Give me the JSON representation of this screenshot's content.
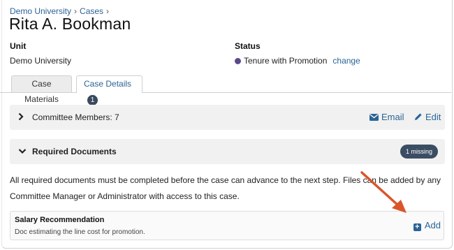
{
  "breadcrumb": {
    "items": [
      "Demo University",
      "Cases"
    ],
    "separator": "›"
  },
  "page": {
    "title": "Rita A. Bookman"
  },
  "fields": {
    "unit_label": "Unit",
    "unit_value": "Demo University",
    "status_label": "Status",
    "status_value": "Tenure with Promotion",
    "status_color": "#5a4a8a",
    "change_label": "change"
  },
  "tabs": [
    {
      "label": "Case Materials",
      "active": false
    },
    {
      "label": "Case Details",
      "active": true,
      "badge": "1"
    }
  ],
  "committee": {
    "title": "Committee Members: 7",
    "email_label": "Email",
    "edit_label": "Edit",
    "email_icon": "envelope-icon",
    "edit_icon": "pencil-icon"
  },
  "required_docs": {
    "title": "Required Documents",
    "missing_badge": "1 missing",
    "description": "All required documents must be completed before the case can advance to the next step. Files can be added by any Committee Manager or Administrator with access to this case."
  },
  "document": {
    "title": "Salary Recommendation",
    "description": "Doc estimating the line cost for promotion.",
    "add_label": "Add",
    "add_icon": "plus-square-icon"
  },
  "colors": {
    "link": "#2a6496",
    "annotation_arrow": "#d9562b",
    "badge": "#3b4d63"
  }
}
